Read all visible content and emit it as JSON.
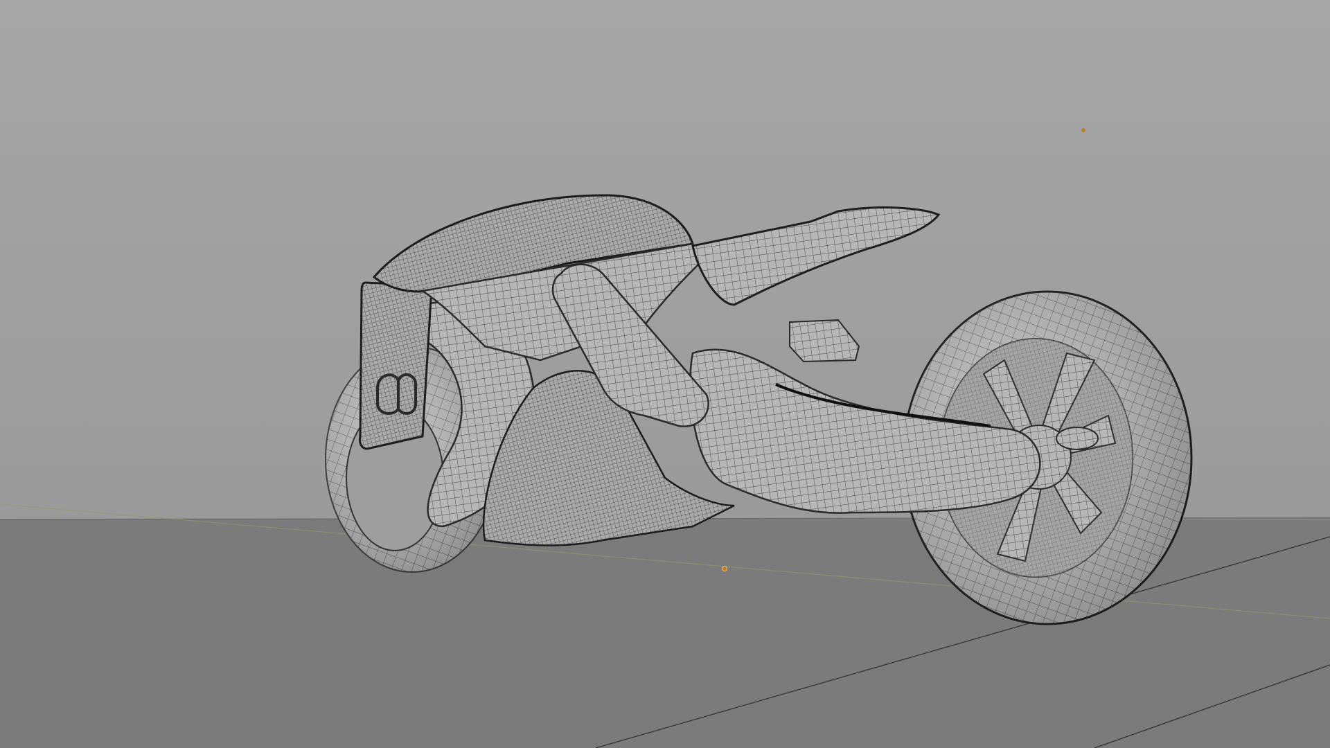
{
  "viewport": {
    "mode": "wireframe-overlay",
    "model": "motorcycle-mesh",
    "colors": {
      "background": "#a3a3a3",
      "ground": "#7b7b7b",
      "mesh_fill": "#b4b4b4",
      "mesh_wire": "#3f3f3f",
      "light_marker": "#c07a2a"
    }
  }
}
